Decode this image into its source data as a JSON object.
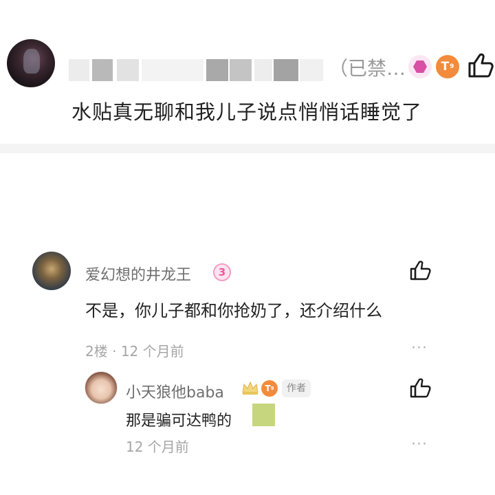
{
  "post_comment": {
    "banned_label": "（已禁…",
    "text": "水贴真无聊和我儿子说点悄悄话睡觉了",
    "badges": {
      "t_letter": "T",
      "t_level": "9"
    },
    "like_icon": "thumbs-up-icon"
  },
  "reply_comment": {
    "username": "爱幻想的井龙王",
    "level": "3",
    "text": "不是，你儿子都和你抢奶了，还介绍什么",
    "floor": "2楼",
    "separator": "·",
    "time": "12 个月前",
    "more": "···"
  },
  "nested_reply": {
    "username": "小天狼他baba",
    "badges": {
      "t_letter": "T",
      "t_level": "9"
    },
    "author_tag": "作者",
    "text": "那是骗可达鸭的",
    "time": "12 个月前",
    "more": "···"
  },
  "colors": {
    "accent_orange": "#f38b3c",
    "accent_pink": "#d94fa6",
    "meta_gray": "#a5a5a5",
    "divider": "#f4f4f5"
  }
}
